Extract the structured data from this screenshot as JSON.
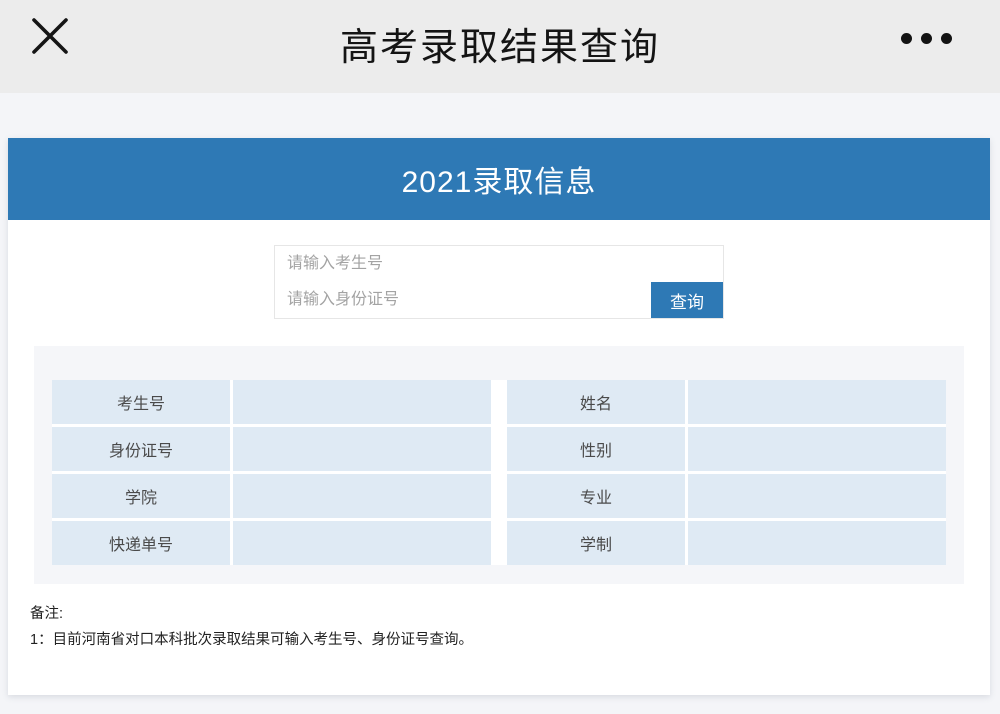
{
  "titlebar": {
    "title": "高考录取结果查询"
  },
  "card": {
    "header": "2021录取信息",
    "form": {
      "candidate_placeholder": "请输入考生号",
      "id_placeholder": "请输入身份证号",
      "query_button": "查询"
    },
    "result_table": {
      "left_rows": [
        {
          "label": "考生号",
          "value": ""
        },
        {
          "label": "身份证号",
          "value": ""
        },
        {
          "label": "学院",
          "value": ""
        },
        {
          "label": "快递单号",
          "value": ""
        }
      ],
      "right_rows": [
        {
          "label": "姓名",
          "value": ""
        },
        {
          "label": "性别",
          "value": ""
        },
        {
          "label": "专业",
          "value": ""
        },
        {
          "label": "学制",
          "value": ""
        }
      ]
    },
    "notes": {
      "heading": "备注:",
      "line1": "1：目前河南省对口本科批次录取结果可输入考生号、身份证号查询。"
    }
  },
  "colors": {
    "accent_blue": "#2e79b5",
    "cell_blue": "#dfeaf4",
    "topbar_gray": "#ececec",
    "page_bg": "#f4f5f8",
    "panel_bg": "#f5f6f9"
  }
}
